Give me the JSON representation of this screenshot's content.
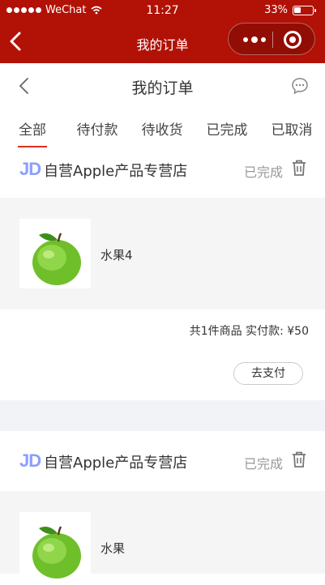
{
  "status_bar": {
    "carrier": "WeChat",
    "time": "11:27",
    "battery": "33%"
  },
  "wechat_nav": {
    "title": "我的订单"
  },
  "page": {
    "title": "我的订单",
    "tabs": [
      {
        "label": "全部"
      },
      {
        "label": "待付款"
      },
      {
        "label": "待收货"
      },
      {
        "label": "已完成"
      },
      {
        "label": "已取消"
      }
    ],
    "active_tab": "全部"
  },
  "orders": [
    {
      "logo": "JD",
      "store": "自营Apple产品专营店",
      "status": "已完成",
      "product_name": "水果4",
      "summary": "共1件商品 实付款: ¥50",
      "action": "去支付"
    },
    {
      "logo": "JD",
      "store": "自营Apple产品专营店",
      "status": "已完成",
      "product_name": "水果"
    }
  ],
  "colors": {
    "nav_red": "#b21106",
    "tab_underline": "#d9321f",
    "jd_logo": "#8c9eff"
  }
}
